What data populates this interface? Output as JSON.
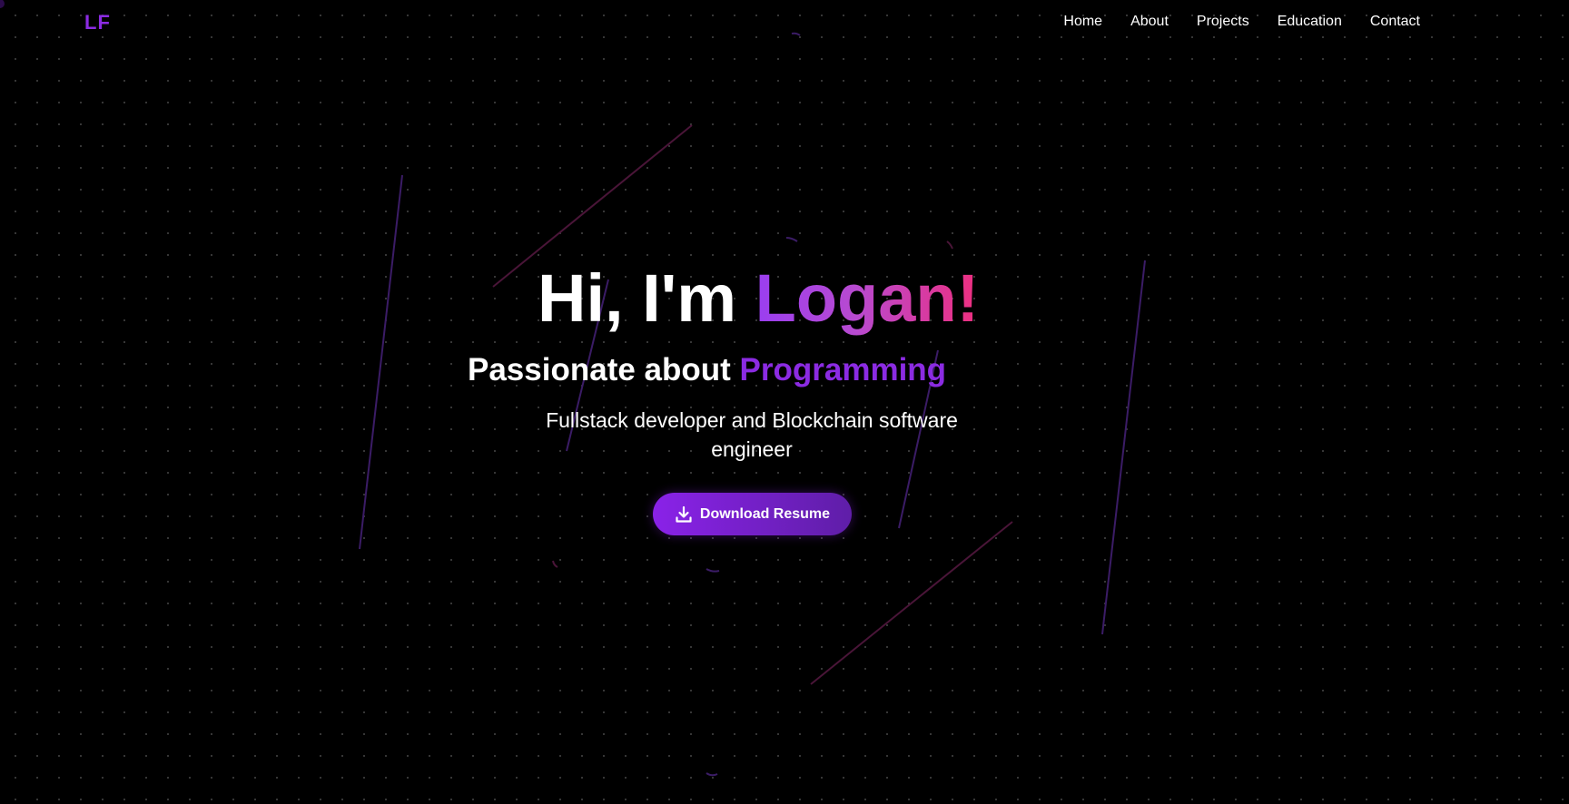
{
  "navbar": {
    "logo": "LF",
    "links": [
      "Home",
      "About",
      "Projects",
      "Education",
      "Contact"
    ]
  },
  "hero": {
    "greeting": "Hi, I'm ",
    "name": "Logan!",
    "subtitle_prefix": "Passionate about ",
    "subtitle_accent": "Programming",
    "description": "Fullstack developer and Blockchain software engineer",
    "button_label": "Download Resume",
    "button_icon": "download-icon"
  },
  "colors": {
    "background": "#000000",
    "accent_purple": "#8b2be2",
    "accent_pink": "#ee2f7f",
    "text": "#ffffff"
  }
}
